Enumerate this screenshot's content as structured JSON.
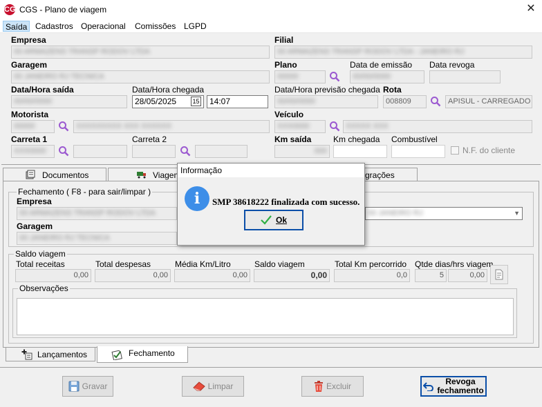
{
  "window": {
    "title": "CGS - Plano de viagem",
    "logo": "CG",
    "close": "✕"
  },
  "menu": [
    {
      "label": "Saída"
    },
    {
      "label": "Cadastros"
    },
    {
      "label": "Operacional"
    },
    {
      "label": "Comissões"
    },
    {
      "label": "LGPD"
    }
  ],
  "form": {
    "empresa_label": "Empresa",
    "empresa_value": "00 ARMAZENS TRANSP RODOV LTDA",
    "filial_label": "Filial",
    "filial_value": "00 ARMAZENS TRANSP RODOV LTDA - JANEIRO RJ",
    "garagem_label": "Garagem",
    "garagem_value": "00 JANEIRO RJ TECNICA",
    "plano_label": "Plano",
    "plano_value": "00000",
    "data_emissao_label": "Data de emissão",
    "data_emissao_value": "00/00/0000",
    "data_revoga_label": "Data revoga",
    "data_revoga_value": "",
    "data_hora_saida_label": "Data/Hora saída",
    "data_saida_value": "00/00/0000",
    "hora_saida_value": "00:00",
    "data_hora_chegada_label": "Data/Hora chegada",
    "data_chegada_value": "28/05/2025",
    "calendar_glyph": "15",
    "hora_chegada_value": "14:07",
    "previsao_label": "Data/Hora previsão chegada",
    "previsao_data_value": "00/00/0000",
    "previsao_hora_value": "00:00",
    "rota_label": "Rota",
    "rota_code": "008809",
    "rota_desc": "APISUL - CARREGADO -",
    "motorista_label": "Motorista",
    "motorista_code": "00000",
    "motorista_name": "XXXXXXXXX XXX XXXXXX",
    "veiculo_label": "Veículo",
    "veiculo_code": "XXX0000",
    "veiculo_desc": "XXXXX XXX",
    "carreta1_label": "Carreta 1",
    "carreta1_code": "XXX0000",
    "carreta2_label": "Carreta 2",
    "km_saida_label": "Km saída",
    "km_saida_value": "000",
    "km_chegada_label": "Km chegada",
    "combustivel_label": "Combustível",
    "nf_cliente_label": "N.F. do cliente"
  },
  "tabs": {
    "documentos": "Documentos",
    "viagem": "Viagem",
    "integracoes": "grações"
  },
  "fechamento": {
    "group_title": "Fechamento ( F8 - para sair/limpar )",
    "empresa_label": "Empresa",
    "empresa_value": "00 ARMAZENS TRANSP RODOV LTDA",
    "filial_value": "00 JANEIRO RJ",
    "garagem_label": "Garagem",
    "garagem_value": "00 JANEIRO RJ TECNICA"
  },
  "saldo": {
    "group_title": "Saldo viagem",
    "total_receitas_label": "Total receitas",
    "total_receitas": "0,00",
    "total_despesas_label": "Total despesas",
    "total_despesas": "0,00",
    "media_km_label": "Média Km/Litro",
    "media_km": "0,00",
    "saldo_viagem_label": "Saldo viagem",
    "saldo_viagem": "0,00",
    "total_km_label": "Total Km percorrido",
    "total_km": "0,0",
    "qtde_dias_label": "Qtde dias/hrs viagem",
    "qtde_dias": "5",
    "qtde_hrs": "0,00"
  },
  "observacoes": {
    "label": "Observações",
    "value": ""
  },
  "bottom_tabs": {
    "lancamentos": "Lançamentos",
    "fechamento": "Fechamento"
  },
  "buttons": {
    "gravar": "Gravar",
    "limpar": "Limpar",
    "excluir": "Excluir",
    "revoga_line1": "Revoga",
    "revoga_line2": "fechamento"
  },
  "dialog": {
    "title": "Informação",
    "icon_glyph": "i",
    "message": "SMP 38618222 finalizada com sucesso.",
    "ok_label": "Ok"
  },
  "colors": {
    "accent": "#0a4ea8",
    "info_icon": "#3d8ee8",
    "search_icon": "#9b59d0",
    "logo": "#c8102e"
  }
}
